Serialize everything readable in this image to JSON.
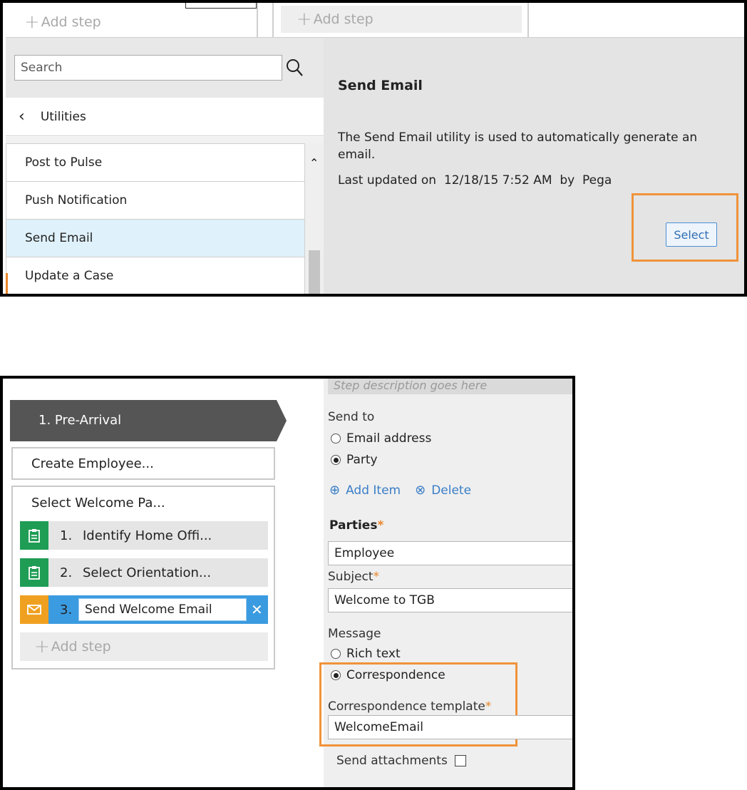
{
  "panel1": {
    "add_step_left": "Add step",
    "add_step_right": "Add step",
    "search_placeholder": "Search",
    "back_label": "Utilities",
    "list_items": [
      "Post to Pulse",
      "Push Notification",
      "Send Email",
      "Update a Case"
    ],
    "selected_item": "Send Email",
    "detail": {
      "title": "Send Email",
      "description": "The Send Email utility is used to automatically generate an email.",
      "updated_prefix": "Last updated on",
      "updated_date": "12/18/15 7:52 AM",
      "updated_by_prefix": "by",
      "updated_by": "Pega",
      "select_label": "Select"
    },
    "colors": {
      "highlight": "#f0933a",
      "selected_row": "#dff1fa",
      "link_blue": "#2f6fb5"
    }
  },
  "panel2": {
    "stage_label": "1.  Pre-Arrival",
    "process1": "Create Employee...",
    "process2": "Select Welcome Pa...",
    "steps": [
      {
        "num": "1.",
        "name": "Identify Home Offi...",
        "icon": "clipboard-icon"
      },
      {
        "num": "2.",
        "name": "Select Orientation...",
        "icon": "clipboard-icon"
      },
      {
        "num": "3.",
        "name": "Send Welcome Email",
        "icon": "envelope-icon"
      }
    ],
    "add_step": "Add step",
    "form": {
      "description_placeholder": "Step description goes here",
      "send_to_label": "Send to",
      "send_to_options": [
        "Email address",
        "Party"
      ],
      "send_to_selected": "Party",
      "add_item": "Add Item",
      "delete": "Delete",
      "parties_label": "Parties",
      "parties_value": "Employee",
      "subject_label": "Subject",
      "subject_value": "Welcome to TGB",
      "message_label": "Message",
      "message_options": [
        "Rich text",
        "Correspondence"
      ],
      "message_selected": "Correspondence",
      "template_label": "Correspondence template",
      "template_value": "WelcomeEmail",
      "attachments_label": "Send attachments",
      "required_mark": "*"
    },
    "colors": {
      "stage_bg": "#555555",
      "step_green": "#1f9d55",
      "step_orange": "#f0a020",
      "step_active": "#3b9be0"
    }
  }
}
